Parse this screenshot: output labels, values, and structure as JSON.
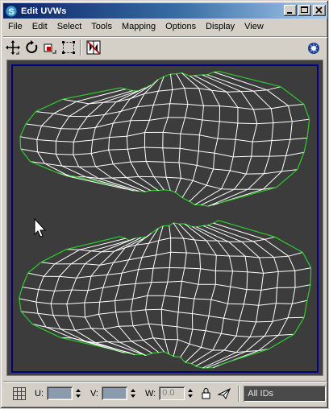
{
  "window": {
    "title": "Edit UVWs",
    "buttons": [
      "minimize-icon",
      "maximize-icon",
      "close-icon"
    ]
  },
  "menu": {
    "items": [
      "File",
      "Edit",
      "Select",
      "Tools",
      "Mapping",
      "Options",
      "Display",
      "View"
    ]
  },
  "toolbar": {
    "tools": [
      "move-icon",
      "rotate-icon",
      "scale-icon",
      "freeform-icon",
      "mirror-icon"
    ],
    "right_tool": "teapot-icon"
  },
  "viewport": {
    "border_color": "#000080",
    "background_color": "#3c3c3c",
    "mesh_edge_color": "#ffffff",
    "boundary_color": "#2ecc2e",
    "cursor": "arrow-cursor-icon"
  },
  "statusbar": {
    "u_label": "U:",
    "v_label": "V:",
    "w_label": "W:",
    "u_value": "",
    "v_value": "",
    "w_value": "0.0",
    "id_filter": "All IDs"
  }
}
